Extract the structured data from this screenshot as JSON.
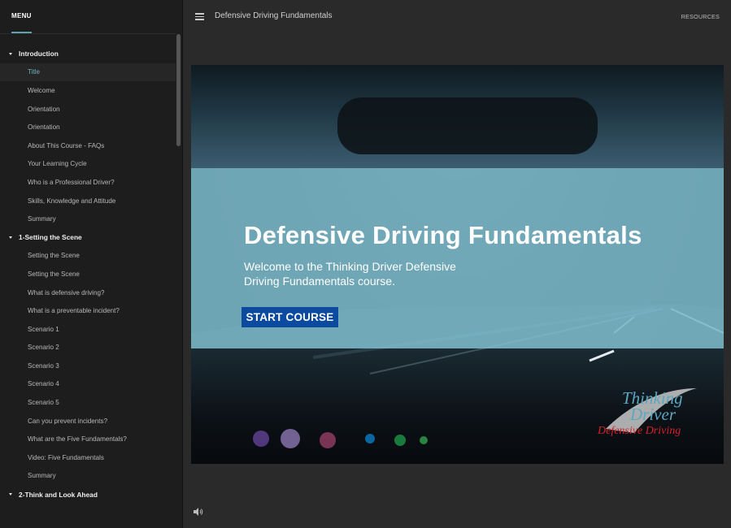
{
  "sidebar": {
    "menu_tab": "MENU",
    "sections": [
      {
        "title": "Introduction",
        "items": [
          {
            "label": "Title",
            "active": true
          },
          {
            "label": "Welcome"
          },
          {
            "label": "Orientation"
          },
          {
            "label": "Orientation"
          },
          {
            "label": "About This Course - FAQs"
          },
          {
            "label": "Your Learning Cycle"
          },
          {
            "label": "Who is a Professional Driver?"
          },
          {
            "label": "Skills, Knowledge and Attitude"
          },
          {
            "label": "Summary"
          }
        ]
      },
      {
        "title": "1-Setting the Scene",
        "items": [
          {
            "label": "Setting the Scene"
          },
          {
            "label": "Setting the Scene"
          },
          {
            "label": "What is defensive driving?"
          },
          {
            "label": "What is a preventable incident?"
          },
          {
            "label": "Scenario 1"
          },
          {
            "label": "Scenario 2"
          },
          {
            "label": "Scenario 3"
          },
          {
            "label": "Scenario 4"
          },
          {
            "label": "Scenario 5"
          },
          {
            "label": "Can you prevent incidents?"
          },
          {
            "label": "What are the Five Fundamentals?"
          },
          {
            "label": "Video: Five Fundamentals"
          },
          {
            "label": "Summary"
          }
        ]
      },
      {
        "title": "2-Think and Look Ahead",
        "items": []
      }
    ]
  },
  "topbar": {
    "course_title": "Defensive Driving Fundamentals",
    "resources_label": "RESOURCES"
  },
  "slide": {
    "title": "Defensive Driving Fundamentals",
    "subtitle": "Welcome to the Thinking Driver Defensive Driving Fundamentals course.",
    "start_button": "START COURSE",
    "logo": {
      "line1": "Thinking",
      "line2": "Driver",
      "tagline": "Defensive Driving"
    }
  },
  "colors": {
    "accent": "#6cb3bb",
    "button": "#0c4aa0",
    "overlay": "#84c4d6",
    "logo_red": "#d2232a"
  }
}
